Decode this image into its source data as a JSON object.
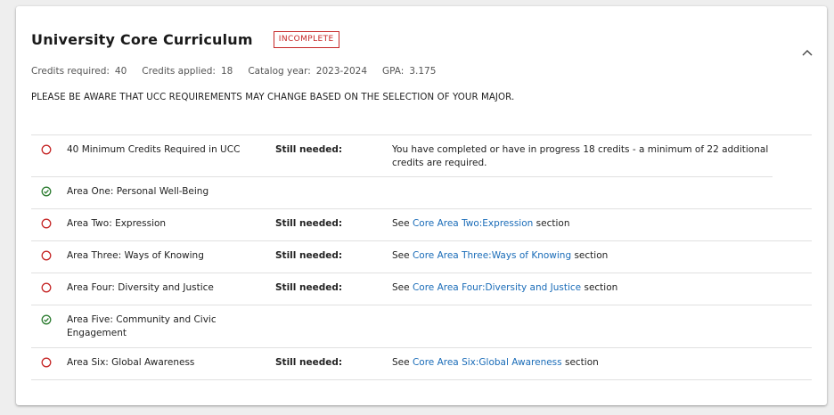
{
  "section": {
    "title": "University Core Curriculum",
    "status_badge": "INCOMPLETE"
  },
  "meta": {
    "credits_required_label": "Credits required:",
    "credits_required_value": "40",
    "credits_applied_label": "Credits applied:",
    "credits_applied_value": "18",
    "catalog_year_label": "Catalog year:",
    "catalog_year_value": "2023-2024",
    "gpa_label": "GPA:",
    "gpa_value": "3.175"
  },
  "notice": "PLEASE BE AWARE THAT UCC REQUIREMENTS MAY CHANGE BASED ON THE SELECTION OF YOUR MAJOR.",
  "colors": {
    "incomplete": "#c62828",
    "complete": "#2e7d32",
    "link": "#1a6cb8"
  },
  "requirements": [
    {
      "status": "incomplete",
      "name": "40 Minimum Credits Required in UCC",
      "label": "Still needed:",
      "detail": "You have completed or have in progress 18 credits - a minimum of 22 additional credits are required."
    },
    {
      "status": "complete",
      "name": "Area One: Personal Well-Being"
    },
    {
      "status": "incomplete",
      "name": "Area Two: Expression",
      "label": "Still needed:",
      "pre": "See",
      "link": "Core Area Two:Expression",
      "post": "section"
    },
    {
      "status": "incomplete",
      "name": "Area Three: Ways of Knowing",
      "label": "Still needed:",
      "pre": "See",
      "link": "Core Area Three:Ways of Knowing",
      "post": "section"
    },
    {
      "status": "incomplete",
      "name": "Area Four: Diversity and Justice",
      "label": "Still needed:",
      "pre": "See",
      "link": "Core Area Four:Diversity and Justice",
      "post": "section"
    },
    {
      "status": "complete",
      "name": "Area Five: Community and Civic Engagement"
    },
    {
      "status": "incomplete",
      "name": "Area Six: Global Awareness",
      "label": "Still needed:",
      "pre": "See",
      "link": "Core Area Six:Global Awareness",
      "post": "section"
    }
  ]
}
